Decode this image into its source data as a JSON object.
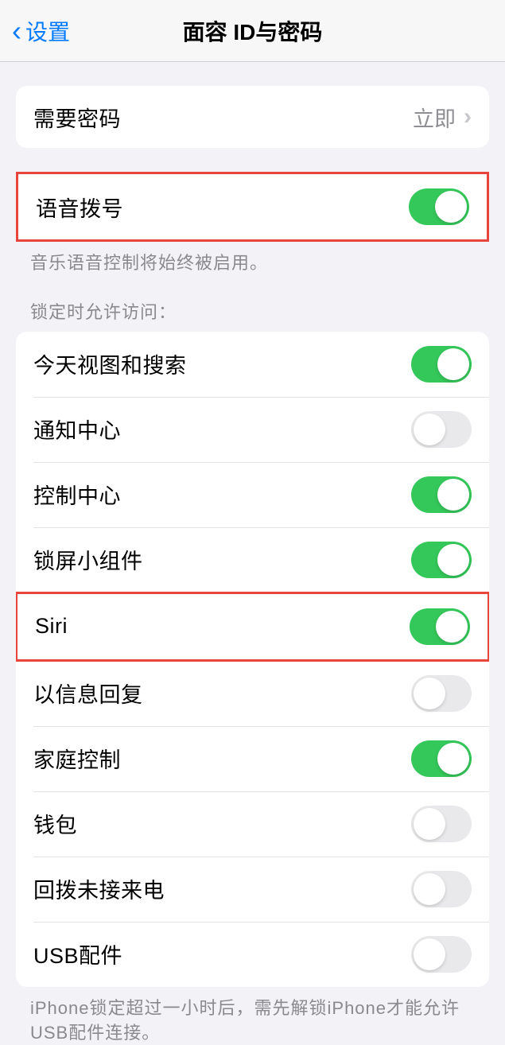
{
  "nav": {
    "back": "设置",
    "title": "面容 ID与密码"
  },
  "requirePasscode": {
    "label": "需要密码",
    "value": "立即"
  },
  "voiceDial": {
    "label": "语音拨号",
    "on": true,
    "footer": "音乐语音控制将始终被启用。"
  },
  "lockedAccess": {
    "header": "锁定时允许访问：",
    "items": [
      {
        "label": "今天视图和搜索",
        "on": true
      },
      {
        "label": "通知中心",
        "on": false
      },
      {
        "label": "控制中心",
        "on": true
      },
      {
        "label": "锁屏小组件",
        "on": true
      },
      {
        "label": "Siri",
        "on": true
      },
      {
        "label": "以信息回复",
        "on": false
      },
      {
        "label": "家庭控制",
        "on": true
      },
      {
        "label": "钱包",
        "on": false
      },
      {
        "label": "回拨未接来电",
        "on": false
      },
      {
        "label": "USB配件",
        "on": false
      }
    ],
    "footer": "iPhone锁定超过一小时后，需先解锁iPhone才能允许USB配件连接。"
  }
}
